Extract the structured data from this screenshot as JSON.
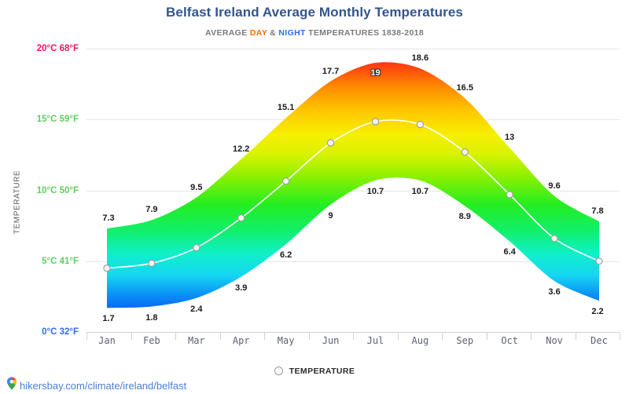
{
  "header": {
    "title": "Belfast Ireland Average Monthly Temperatures",
    "subtitle_pre": "AVERAGE ",
    "subtitle_day": "DAY",
    "subtitle_amp": " & ",
    "subtitle_night": "NIGHT",
    "subtitle_post": " TEMPERATURES 1838-2018"
  },
  "axis": {
    "y_title": "TEMPERATURE",
    "y_ticks": [
      {
        "label": "20°C 68°F",
        "value": 20,
        "color": "#f4145f"
      },
      {
        "label": "15°C 59°F",
        "value": 15,
        "color": "#5ece5e"
      },
      {
        "label": "10°C 50°F",
        "value": 10,
        "color": "#5ece5e"
      },
      {
        "label": "5°C 41°F",
        "value": 5,
        "color": "#5ece5e"
      },
      {
        "label": "0°C 32°F",
        "value": 0,
        "color": "#2f6bff"
      }
    ]
  },
  "legend": {
    "marker": "circle-marker-icon",
    "label": "TEMPERATURE"
  },
  "footer": {
    "icon": "map-pin-icon",
    "url": "hikersbay.com/climate/ireland/belfast"
  },
  "chart_data": {
    "type": "area",
    "title": "Belfast Ireland Average Monthly Temperatures",
    "subtitle": "AVERAGE DAY & NIGHT TEMPERATURES 1838-2018",
    "xlabel": "",
    "ylabel": "TEMPERATURE",
    "ylim": [
      0,
      21.5
    ],
    "grid": true,
    "legend_position": "bottom-center",
    "categories": [
      "Jan",
      "Feb",
      "Mar",
      "Apr",
      "May",
      "Jun",
      "Jul",
      "Aug",
      "Sep",
      "Oct",
      "Nov",
      "Dec"
    ],
    "series": [
      {
        "name": "DAY",
        "values": [
          7.3,
          7.9,
          9.5,
          12.2,
          15.1,
          17.7,
          19,
          18.6,
          16.5,
          13,
          9.6,
          7.8
        ],
        "labels": [
          "7.3",
          "7.9",
          "9.5",
          "12.2",
          "15.1",
          "17.7",
          "19",
          "18.6",
          "16.5",
          "13",
          "9.6",
          "7.8"
        ],
        "label_inverted": [
          false,
          false,
          false,
          false,
          false,
          false,
          true,
          false,
          false,
          false,
          false,
          false
        ]
      },
      {
        "name": "NIGHT",
        "values": [
          1.7,
          1.8,
          2.4,
          3.9,
          6.2,
          9,
          10.7,
          10.7,
          8.9,
          6.4,
          3.6,
          2.2
        ],
        "labels": [
          "1.7",
          "1.8",
          "2.4",
          "3.9",
          "6.2",
          "9",
          "10.7",
          "10.7",
          "8.9",
          "6.4",
          "3.6",
          "2.2"
        ]
      },
      {
        "name": "TEMPERATURE",
        "values": [
          4.5,
          4.85,
          5.95,
          8.05,
          10.65,
          13.35,
          14.85,
          14.65,
          12.7,
          9.7,
          6.6,
          5.0
        ]
      }
    ]
  }
}
